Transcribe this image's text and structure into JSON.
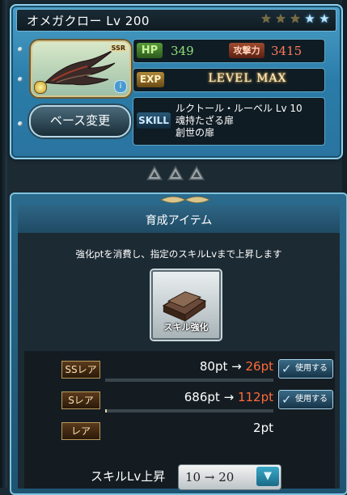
{
  "card": {
    "title": "オメガクロー Lv 200",
    "stars": {
      "filled": 3,
      "total": 5
    },
    "rarity_badge": "SSR",
    "hp_label": "HP",
    "hp_value": "349",
    "atk_label": "攻撃力",
    "atk_value": "3415",
    "exp_label": "EXP",
    "exp_value": "LEVEL MAX",
    "base_change_label": "ベース変更",
    "skill_label": "SKILL",
    "skills": [
      "ルクトール・ルーベル Lv 10",
      "魂持たざる扉",
      "創世の扉"
    ]
  },
  "panel": {
    "title": "育成アイテム",
    "description": "強化ptを消費し、指定のスキルLvまで上昇します",
    "item_label": "スキル強化",
    "rows": [
      {
        "rarity": "SSレア",
        "before": "80pt",
        "arrow": "→",
        "after": "26pt",
        "use_label": "使用する",
        "bar_fill": 0.0
      },
      {
        "rarity": "Sレア",
        "before": "686pt",
        "arrow": "→",
        "after": "112pt",
        "use_label": "使用する",
        "bar_fill": 0.01
      },
      {
        "rarity": "レア",
        "value": "2pt"
      }
    ],
    "skill_lv_label": "スキルLv上昇",
    "skill_lv_value": "10 → 20"
  },
  "colors": {
    "accent": "#2a7ca8",
    "hp": "#8fe07a",
    "atk": "#ff7a5a",
    "after": "#ff6a3a"
  }
}
